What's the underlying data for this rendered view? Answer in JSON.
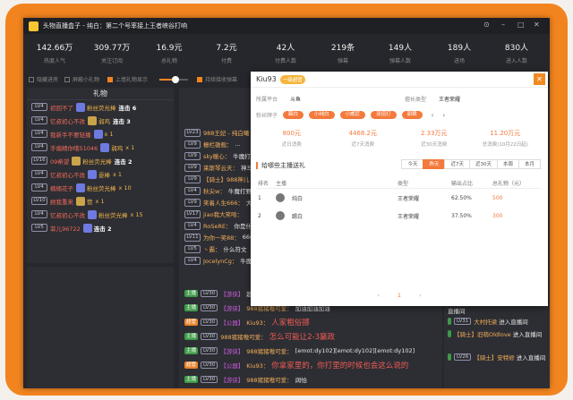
{
  "window": {
    "title": "头物直播盒子 - 纯白：第二个号率接上王者峡谷打响",
    "controls": [
      "⊙",
      "–",
      "□",
      "✕"
    ]
  },
  "stats": [
    {
      "value": "142.66万",
      "label": "热度人气"
    },
    {
      "value": "309.77万",
      "label": "关注订阅"
    },
    {
      "value": "16.9元",
      "label": "总礼物"
    },
    {
      "value": "7.2元",
      "label": "付费"
    },
    {
      "value": "42人",
      "label": "付费人数"
    },
    {
      "value": "219条",
      "label": "弹幕"
    },
    {
      "value": "149人",
      "label": "弹幕人数"
    },
    {
      "value": "189人",
      "label": "进场"
    },
    {
      "value": "830人",
      "label": "进入人数"
    }
  ],
  "options": {
    "opt1": "隐藏进房",
    "opt2": "屏蔽小礼物",
    "opt3": "上墙礼物显示",
    "opt4": "持续接收弹幕"
  },
  "slider": {
    "level": 0.55
  },
  "gift_panel": {
    "title": "礼物",
    "rows": [
      {
        "lv": "LV4",
        "user": "初回不了",
        "gift": "粉丝荧光棒",
        "combo": "连击 6"
      },
      {
        "lv": "LV4",
        "user": "忆叔初心不改",
        "gift": "弱鸡",
        "combo": "连击 3"
      },
      {
        "lv": "LV4",
        "user": "我新手不要轻播",
        "gift": "",
        "count": "x 1"
      },
      {
        "lv": "LV4",
        "user": "手偏精你哦51046",
        "gift": "弱鸡",
        "count": "x 1"
      },
      {
        "lv": "LV16",
        "user": "09希望",
        "gift": "粉丝荧光棒",
        "combo": "连击 2"
      },
      {
        "lv": "LV4",
        "user": "忆叔初心不改",
        "gift": "耍棒",
        "count": "x 1"
      },
      {
        "lv": "LV4",
        "user": "楠楠花子",
        "gift": "粉丝荧光棒",
        "count": "x 10"
      },
      {
        "lv": "LV10",
        "user": "顾我重来",
        "gift": "赞",
        "count": "x 1"
      },
      {
        "lv": "LV4",
        "user": "忆叔初心不改",
        "gift": "粉丝荧光棒",
        "count": "x 15"
      },
      {
        "lv": "LV5",
        "user": "菲儿96722",
        "gift": "",
        "combo": "连击 2"
      }
    ]
  },
  "chat_top": [
    {
      "lv": "LV23",
      "name": "988王妃 - 纯白曦",
      "msg": ""
    },
    {
      "lv": "LV9",
      "name": "栅栏雄舰：",
      "msg": "..."
    },
    {
      "lv": "LV9",
      "name": "sky暖心：",
      "msg": "牛魔打下"
    },
    {
      "lv": "LV9",
      "name": "莱斯琴云天：",
      "msg": "神马"
    },
    {
      "lv": "LV9",
      "name": "【骑士】988神儿",
      "msg": ""
    },
    {
      "lv": "LV4",
      "name": "秋尖w：",
      "msg": "牛魔打野"
    },
    {
      "lv": "LV9",
      "name": "笑着人生666：",
      "msg": "大"
    },
    {
      "lv": "LV17",
      "name": "jiao我大笑哈：",
      "msg": ""
    },
    {
      "lv": "LV4",
      "name": "RoSeRE：",
      "msg": "你是什么"
    },
    {
      "lv": "LV11",
      "name": "为你一笑88：",
      "msg": "6666"
    },
    {
      "lv": "LV5",
      "name": "丶霸：",
      "msg": "什么符文"
    },
    {
      "lv": "LV4",
      "name": "JocelynCg：",
      "msg": "牛魔"
    }
  ],
  "chat_bottom": [
    {
      "tag": "主播",
      "lv": "LV30",
      "sys": "【游侠】",
      "name": "",
      "msg": "超越超越"
    },
    {
      "tag": "主播",
      "lv": "LV30",
      "sys": "【游侠】",
      "name": "988猪猪嗷可爱：",
      "msg": "加油加油加油"
    },
    {
      "tag": "超管",
      "lv": "LV30",
      "sys": "【公器】",
      "name": "Kiu93：",
      "msg": "人家粗俗挪",
      "big": true
    },
    {
      "tag": "主播",
      "lv": "LV30",
      "sys": "",
      "name": "988猪猪嗷可爱：",
      "msg": "怎么可能让2-3赢政",
      "big": true
    },
    {
      "tag": "主播",
      "lv": "LV30",
      "sys": "【游侠】",
      "name": "988猪猪嗷可爱：",
      "msg": "[emot:dy102][emot:dy102][emot:dy102]"
    },
    {
      "tag": "超管",
      "lv": "LV30",
      "sys": "【公器】",
      "name": "Kiu93：",
      "msg": "你拿家里的，你打里的时候也会这么说的",
      "big": true
    },
    {
      "tag": "主播",
      "lv": "LV30",
      "sys": "【游侠】",
      "name": "988猪猪嗷可爱：",
      "msg": "阔怕"
    }
  ],
  "right_panel": [
    {
      "text": "直播间"
    },
    {
      "lv": "LV31",
      "name": "大村托梁",
      "msg": "进入直播间"
    },
    {
      "lv": "",
      "name": "【骑士】旧萌Oldlove",
      "msg": "进入直播间"
    },
    {
      "lv": "LV26",
      "name": "【骑士】安特修",
      "msg": "进入直播间"
    }
  ],
  "modal": {
    "user": "Kiu93",
    "badge": "一级超管",
    "close": "✕",
    "platform_label": "所属平台",
    "platform_value": "斗鱼",
    "category_label": "擅长类型",
    "category_value": "王者荣耀",
    "pills_label": "粉丝牌子",
    "pills": [
      "踢白",
      "小纯白",
      "小威尼",
      "双倍打",
      "甜粮"
    ],
    "kpis": [
      {
        "value": "800元",
        "label": "近日消费"
      },
      {
        "value": "4468.2元",
        "label": "近7天消费"
      },
      {
        "value": "2.33万元",
        "label": "近30天消费"
      },
      {
        "value": "11.20万元",
        "label": "总消费(10月22日起)"
      }
    ],
    "section_title": "给哪些主播送礼",
    "tabs": [
      "今天",
      "昨天",
      "近7天",
      "近30天",
      "本周",
      "本月"
    ],
    "active_tab": 1,
    "table": {
      "headers": [
        "排名",
        "主播",
        "类型",
        "输出占比",
        "总礼物（元）"
      ],
      "rows": [
        {
          "rank": "1",
          "name": "纯白",
          "type": "王者荣耀",
          "share": "62.50%",
          "total": "500"
        },
        {
          "rank": "2",
          "name": "踢白",
          "type": "王者荣耀",
          "share": "37.50%",
          "total": "300"
        }
      ]
    },
    "pager": {
      "prev": "‹",
      "page": "1",
      "next": "›"
    }
  }
}
